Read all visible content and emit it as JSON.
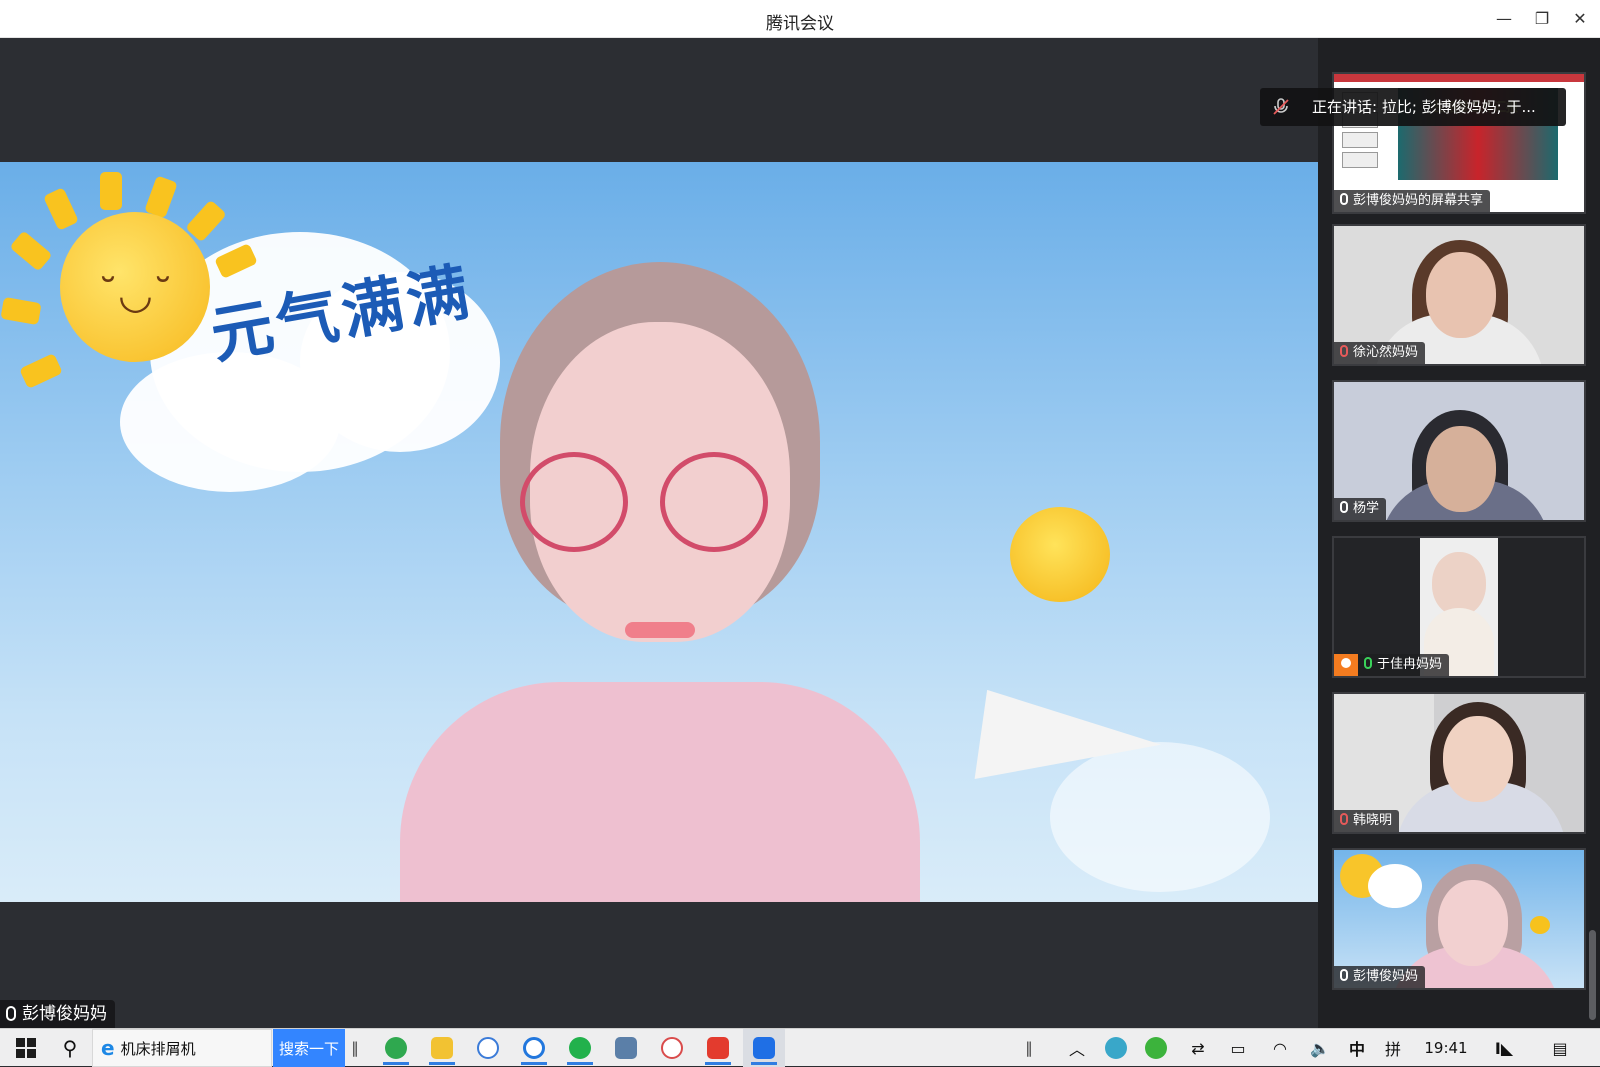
{
  "window": {
    "title": "腾讯会议",
    "minimize_icon": "minimize-icon",
    "maximize_icon": "restore-icon",
    "close_icon": "close-icon"
  },
  "main_speaker": {
    "name": "彭博俊妈妈",
    "background_slogan": "元气满满"
  },
  "speaking_banner": {
    "text": "正在讲话: 拉比; 彭博俊妈妈; 于..."
  },
  "participants": [
    {
      "name": "彭博俊妈妈的屏幕共享",
      "mic": "on",
      "type": "screen-share"
    },
    {
      "name": "徐沁然妈妈",
      "mic": "muted",
      "type": "video"
    },
    {
      "name": "杨学",
      "mic": "on",
      "type": "video"
    },
    {
      "name": "于佳冉妈妈",
      "mic": "active",
      "type": "video"
    },
    {
      "name": "韩晓明",
      "mic": "muted",
      "type": "video"
    },
    {
      "name": "彭博俊妈妈",
      "mic": "on",
      "type": "video"
    }
  ],
  "taskbar": {
    "search_text": "机床排屑机",
    "search_button": "搜索一下",
    "ime_lang": "中",
    "ime_mode": "拼",
    "clock": "19:41",
    "tray_up_icon": "chevron-up-icon",
    "volume_icon": "volume-icon",
    "notification_icon": "notification-icon"
  },
  "colors": {
    "accent": "#3385ff",
    "muted_mic": "#e65a5a",
    "active_mic": "#3ad15a",
    "host_badge": "#f47c20"
  }
}
